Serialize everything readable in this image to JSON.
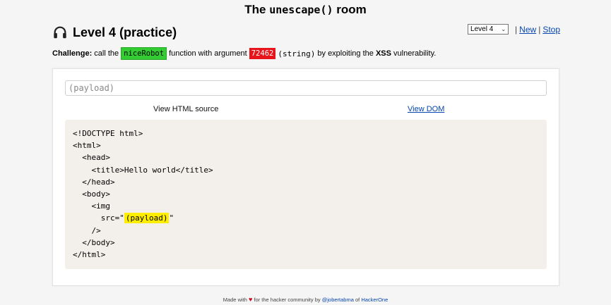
{
  "header": {
    "title_prefix": "The ",
    "title_code": "unescape()",
    "title_suffix": " room"
  },
  "level": {
    "heading": "Level 4 (practice)",
    "icon": "headphones-icon"
  },
  "controls": {
    "select_value": "Level 4",
    "sep1": "|",
    "new_label": "New",
    "sep2": "|",
    "stop_label": "Stop"
  },
  "challenge": {
    "label": "Challenge:",
    "text1": "call the",
    "function_name": "niceRobot",
    "text2": "function with argument",
    "argument": "72462",
    "arg_type": "(string)",
    "text3": "by exploiting the",
    "vuln": "XSS",
    "text4": "vulnerability."
  },
  "payload": {
    "placeholder": "(payload)"
  },
  "tabs": {
    "html_source": "View HTML source",
    "dom": "View DOM"
  },
  "code": {
    "lines": [
      "<!DOCTYPE html>",
      "<html>",
      "  <head>",
      "    <title>Hello world</title>",
      "  </head>",
      "  <body>",
      "    <img",
      "      src=\"",
      "    />",
      "  </body>",
      "</html>"
    ],
    "payload_highlight": "(payload)",
    "src_close": "\""
  },
  "footer": {
    "made_with": "Made with",
    "for_text": "for the hacker community by",
    "author": "@jobertabma",
    "of": "of",
    "company": "HackerOne"
  },
  "colors": {
    "green_tag": "#33cc33",
    "red_tag": "#e8141b",
    "highlight": "#ffee00",
    "link": "#0645ad"
  }
}
